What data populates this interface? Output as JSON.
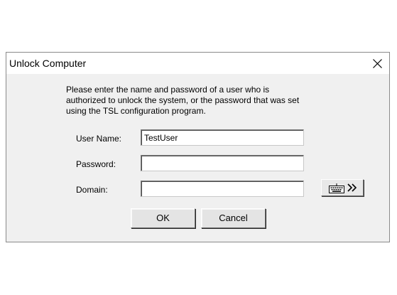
{
  "dialog": {
    "title": "Unlock Computer",
    "message_lines": [
      "Please enter the name and password of a user who is",
      "authorized to unlock the system, or the password that was set",
      "using the TSL configuration program."
    ],
    "fields": {
      "user_name": {
        "label": "User Name:",
        "value": "TestUser"
      },
      "password": {
        "label": "Password:",
        "value": ""
      },
      "domain": {
        "label": "Domain:",
        "value": ""
      }
    },
    "keyboard_button": {
      "icon": "keyboard-icon",
      "arrows": "»"
    },
    "buttons": {
      "ok": "OK",
      "cancel": "Cancel"
    }
  }
}
